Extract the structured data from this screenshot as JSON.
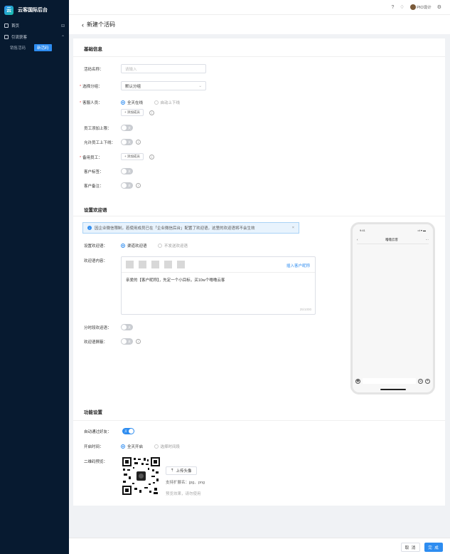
{
  "app": {
    "logo_icon": "cloud-logo-icon",
    "logo_glyph": "云",
    "title": "云客国际后台"
  },
  "sidebar": {
    "home_label": "首页",
    "group_label": "引流获客",
    "sub_items": [
      {
        "label": "销售活码"
      },
      {
        "label": "新活码"
      }
    ]
  },
  "topbar": {
    "user_name": "PIO设计",
    "icons": [
      "help-icon",
      "bell-icon",
      "settings-icon"
    ]
  },
  "page": {
    "title": "新建个活码",
    "back_glyph": "‹"
  },
  "basic": {
    "section_title": "基础信息",
    "name_label": "活码名称：",
    "name_placeholder": "请输入",
    "group_label": "选择分组：",
    "group_value": "默认分组",
    "staff_label": "客服人员：",
    "staff_options": [
      "全天在线",
      "自动上下线"
    ],
    "add_member": "+ 添加成员",
    "limit_label": "员工添加上限：",
    "online_label": "允许员工上下线：",
    "backup_label": "备用员工：",
    "backup_add": "+ 添加成员",
    "tag_label": "客户标签：",
    "remark_label": "客户备注：",
    "switch_off": "关"
  },
  "welcome": {
    "section_title": "设置欢迎语",
    "alert": "因企业微信限制，若使用成员已在「企业微信后台」配置了欢迎语，这里的欢迎语将不会生效",
    "alert_close": "×",
    "setting_label": "设置欢迎语：",
    "options": [
      "渠道欢迎语",
      "不发送欢迎语"
    ],
    "content_label": "欢迎语内容：",
    "insert_link": "插入客户昵称",
    "content_text": "亲爱的【客户昵称】，先定一个小目标，买10w个噜噜云客",
    "count": "25/1000",
    "timed_label": "分时段欢迎语：",
    "shield_label": "欢迎语屏蔽："
  },
  "phone": {
    "time": "9:41",
    "title": "噜噜云客",
    "back": "‹",
    "more": "···",
    "signal": "•ıl ▾ ▬"
  },
  "function": {
    "section_title": "功能设置",
    "auto_label": "自动通过好友：",
    "auto_on": "开",
    "time_label": "开启时间：",
    "time_options": [
      "全天开启",
      "选择时间段"
    ],
    "qr_label": "二维码预览：",
    "upload_label": "上传头像",
    "upload_hint": "支持扩展名：jpg、png",
    "preview_hint": "预览效果，请勿使用"
  },
  "footer": {
    "cancel": "取 消",
    "finish": "完 成"
  },
  "colors": {
    "accent": "#2d8cf0",
    "sidebar_bg": "#071a30",
    "required": "#e84545"
  }
}
